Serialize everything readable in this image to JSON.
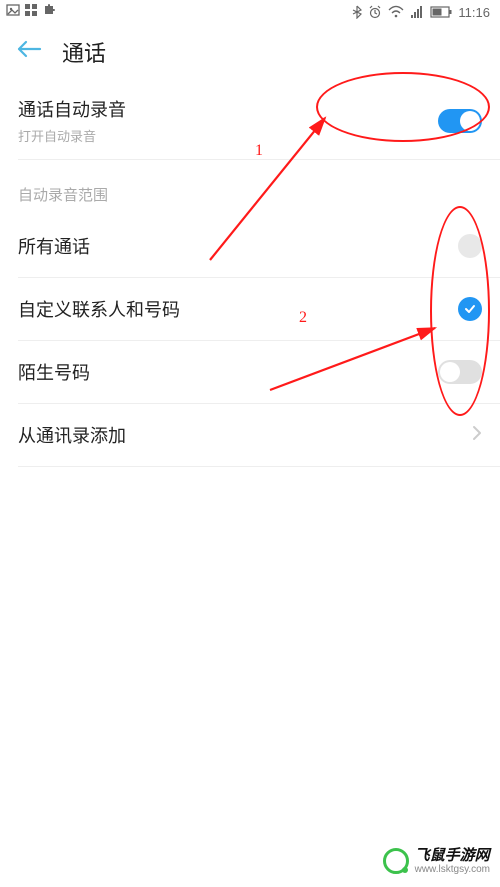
{
  "status": {
    "time": "11:16"
  },
  "header": {
    "title": "通话"
  },
  "auto_record": {
    "title": "通话自动录音",
    "subtitle": "打开自动录音",
    "enabled": true
  },
  "section": {
    "label": "自动录音范围"
  },
  "options": {
    "all_calls": {
      "label": "所有通话",
      "selected": false
    },
    "custom": {
      "label": "自定义联系人和号码",
      "selected": true
    },
    "unknown": {
      "label": "陌生号码",
      "enabled": false
    }
  },
  "add_from_contacts": {
    "label": "从通讯录添加"
  },
  "annotations": {
    "label1": "1",
    "label2": "2"
  },
  "watermark": {
    "title": "飞鼠手游网",
    "url": "www.lsktgsy.com"
  }
}
